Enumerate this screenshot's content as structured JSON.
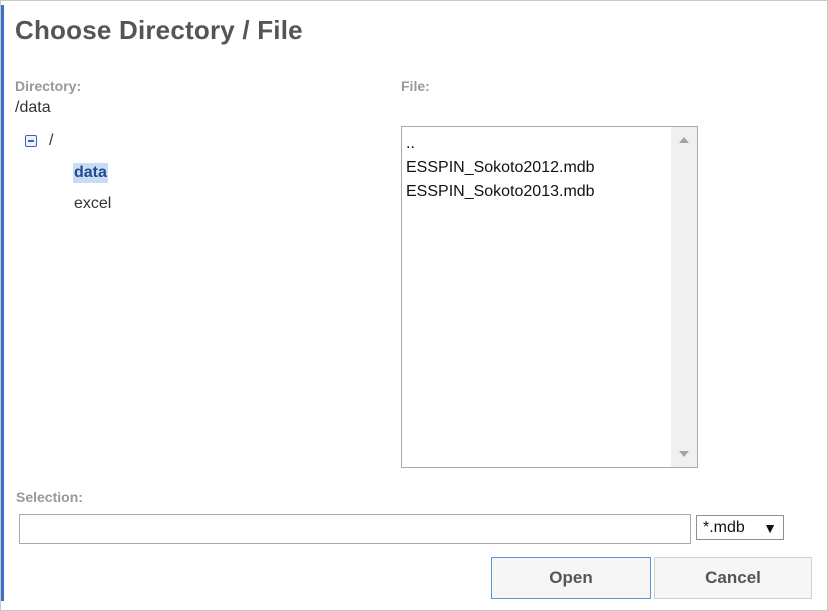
{
  "dialog": {
    "title": "Choose Directory / File"
  },
  "directory": {
    "label": "Directory:",
    "current_path": "/data",
    "tree": {
      "root_label": "/",
      "children": [
        {
          "label": "data",
          "selected": true
        },
        {
          "label": "excel",
          "selected": false
        }
      ]
    }
  },
  "file": {
    "label": "File:",
    "items": [
      "..",
      "ESSPIN_Sokoto2012.mdb",
      "ESSPIN_Sokoto2013.mdb"
    ]
  },
  "selection": {
    "label": "Selection:",
    "value": "",
    "filter": "*.mdb"
  },
  "buttons": {
    "open": "Open",
    "cancel": "Cancel"
  },
  "colors": {
    "accent": "#3a6fc4",
    "selected_bg": "#c8dcf3"
  }
}
